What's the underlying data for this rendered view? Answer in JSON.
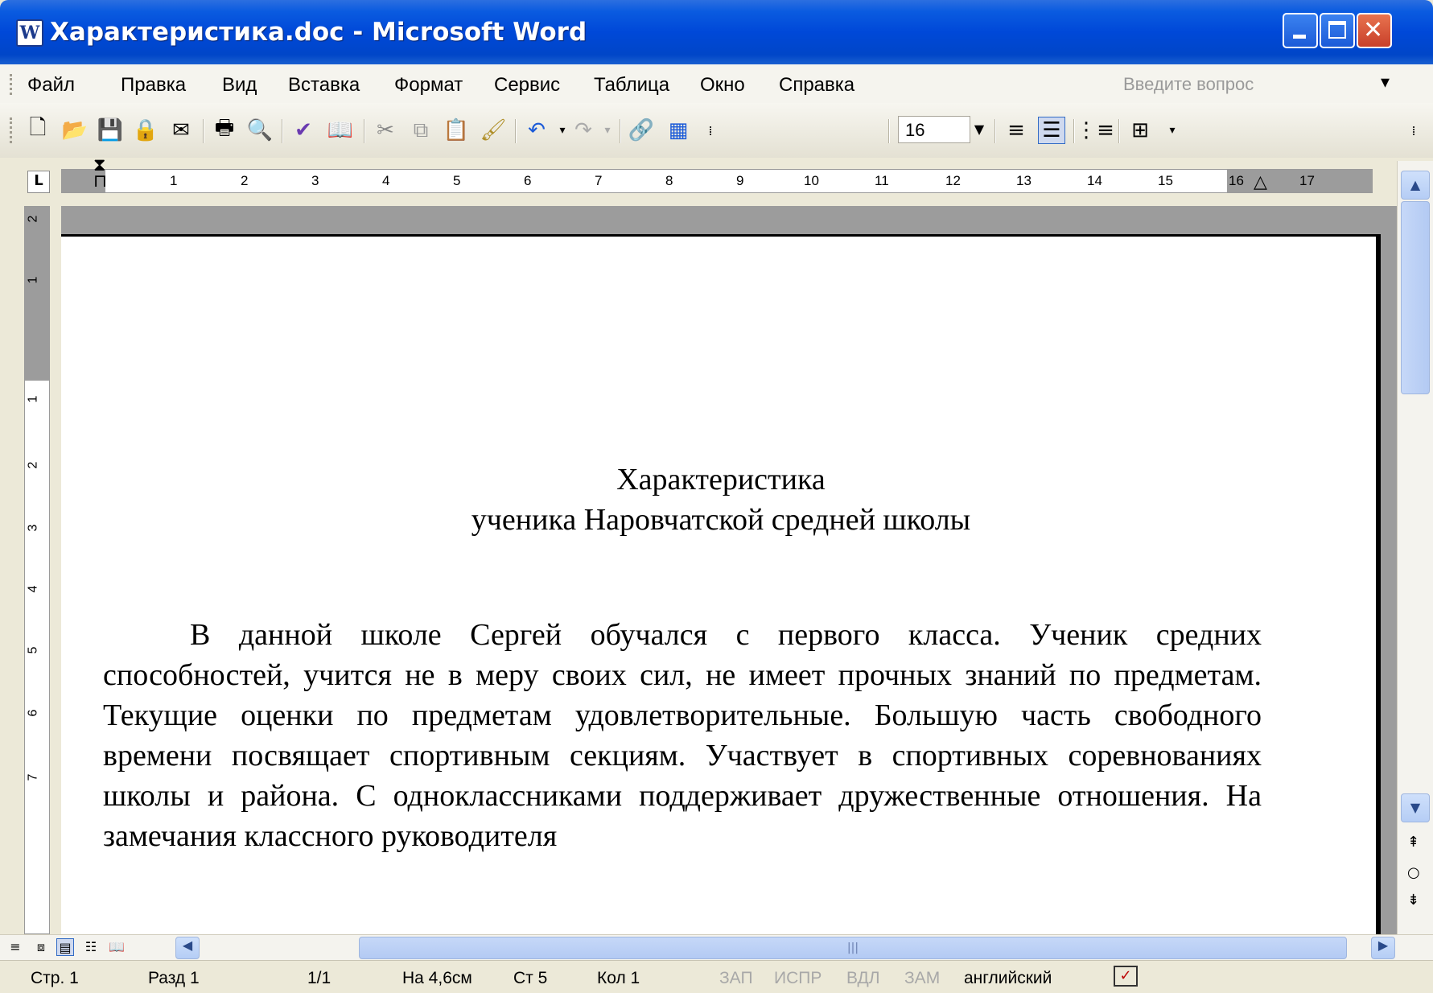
{
  "window": {
    "title": "Характеристика.doc - Microsoft Word",
    "icon": "word-doc-icon"
  },
  "menu": {
    "items": [
      "Файл",
      "Правка",
      "Вид",
      "Вставка",
      "Формат",
      "Сервис",
      "Таблица",
      "Окно",
      "Справка"
    ],
    "help_placeholder": "Введите вопрос"
  },
  "toolbar": {
    "font_size": "16",
    "icons": [
      "new-icon",
      "open-icon",
      "save-icon",
      "permission-icon",
      "email-icon",
      "print-icon",
      "print-preview-icon",
      "spelling-icon",
      "research-icon",
      "cut-icon",
      "copy-icon",
      "paste-icon",
      "format-painter-icon",
      "undo-icon",
      "redo-icon",
      "hyperlink-icon",
      "table-icon",
      "align-left-icon",
      "justify-icon",
      "numbering-icon",
      "border-icon"
    ]
  },
  "ruler": {
    "horizontal_marks": [
      "1",
      "2",
      "3",
      "4",
      "5",
      "6",
      "7",
      "8",
      "9",
      "10",
      "11",
      "12",
      "13",
      "14",
      "15",
      "16",
      "17"
    ],
    "vertical_marks": [
      "2",
      "1",
      "1",
      "2",
      "3",
      "4",
      "5",
      "6",
      "7"
    ]
  },
  "document": {
    "title_line1": "Характеристика",
    "title_line2": "ученика Наровчатской средней школы",
    "paragraph": "В данной школе Сергей обучался с первого класса. Ученик средних способностей, учится не в меру своих сил, не имеет прочных знаний по предметам. Текущие оценки по предметам удовлетворительные. Большую часть свободного времени посвящает спортивным секциям. Участвует в спортивных соревнованиях школы и района. С одноклассниками поддерживает дружественные отношения. На замечания классного руководителя"
  },
  "statusbar": {
    "page": "Стр. 1",
    "section": "Разд 1",
    "pages": "1/1",
    "position": "На 4,6см",
    "line": "Ст 5",
    "column": "Кол 1",
    "rec": "ЗАП",
    "trk": "ИСПР",
    "ext": "ВДЛ",
    "ovr": "ЗАМ",
    "language": "английский"
  }
}
